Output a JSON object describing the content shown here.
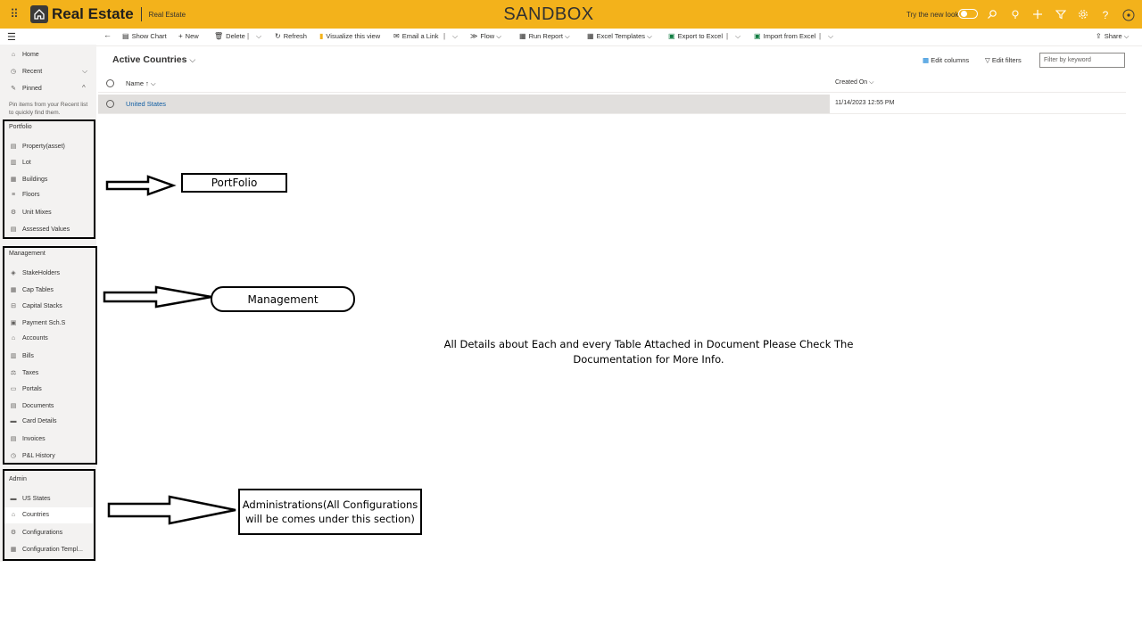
{
  "header": {
    "waffle_icon": "waffle-icon",
    "app_name": "Real Estate",
    "app_subtitle": "Real Estate",
    "environment": "SANDBOX",
    "try_new_look": "Try the new look",
    "brand_color": "#f3b21b"
  },
  "commandbar": {
    "back": "←",
    "show_chart": "Show Chart",
    "new": "New",
    "delete": "Delete",
    "refresh": "Refresh",
    "visualize": "Visualize this view",
    "email_link": "Email a Link",
    "flow": "Flow",
    "run_report": "Run Report",
    "excel_templates": "Excel Templates",
    "export_excel": "Export to Excel",
    "import_excel": "Import from Excel",
    "share": "Share"
  },
  "sidebar": {
    "home": "Home",
    "recent": "Recent",
    "pinned": "Pinned",
    "pin_hint": "Pin items from your Recent list to quickly find them.",
    "portfolio_title": "Portfolio",
    "portfolio": [
      "Property(asset)",
      "Lot",
      "Buildings",
      "Floors",
      "Unit Mixes",
      "Assessed Values"
    ],
    "management_title": "Management",
    "management": [
      "StakeHolders",
      "Cap Tables",
      "Capital Stacks",
      "Payment Sch.S",
      "Accounts",
      "Bills",
      "Taxes",
      "Portals",
      "Documents",
      "Card Details",
      "Invoices",
      "P&L History"
    ],
    "admin_title": "Admin",
    "admin": [
      "US States",
      "Countries",
      "Configurations",
      "Configuration Templ..."
    ]
  },
  "main": {
    "view_title": "Active Countries",
    "edit_columns": "Edit columns",
    "edit_filters": "Edit filters",
    "filter_placeholder": "Filter by keyword",
    "columns": [
      "Name ↑",
      "Created On"
    ],
    "rows": [
      {
        "name": "United States",
        "created_on": "11/14/2023 12:55 PM"
      }
    ]
  },
  "annotations": {
    "portfolio_label": "PortFolio",
    "management_label": "Management",
    "admin_label": "Administrations(All Configurations will be comes under this section)",
    "center_note": "All Details about Each and every Table Attached in Document Please Check The Documentation for More Info."
  }
}
